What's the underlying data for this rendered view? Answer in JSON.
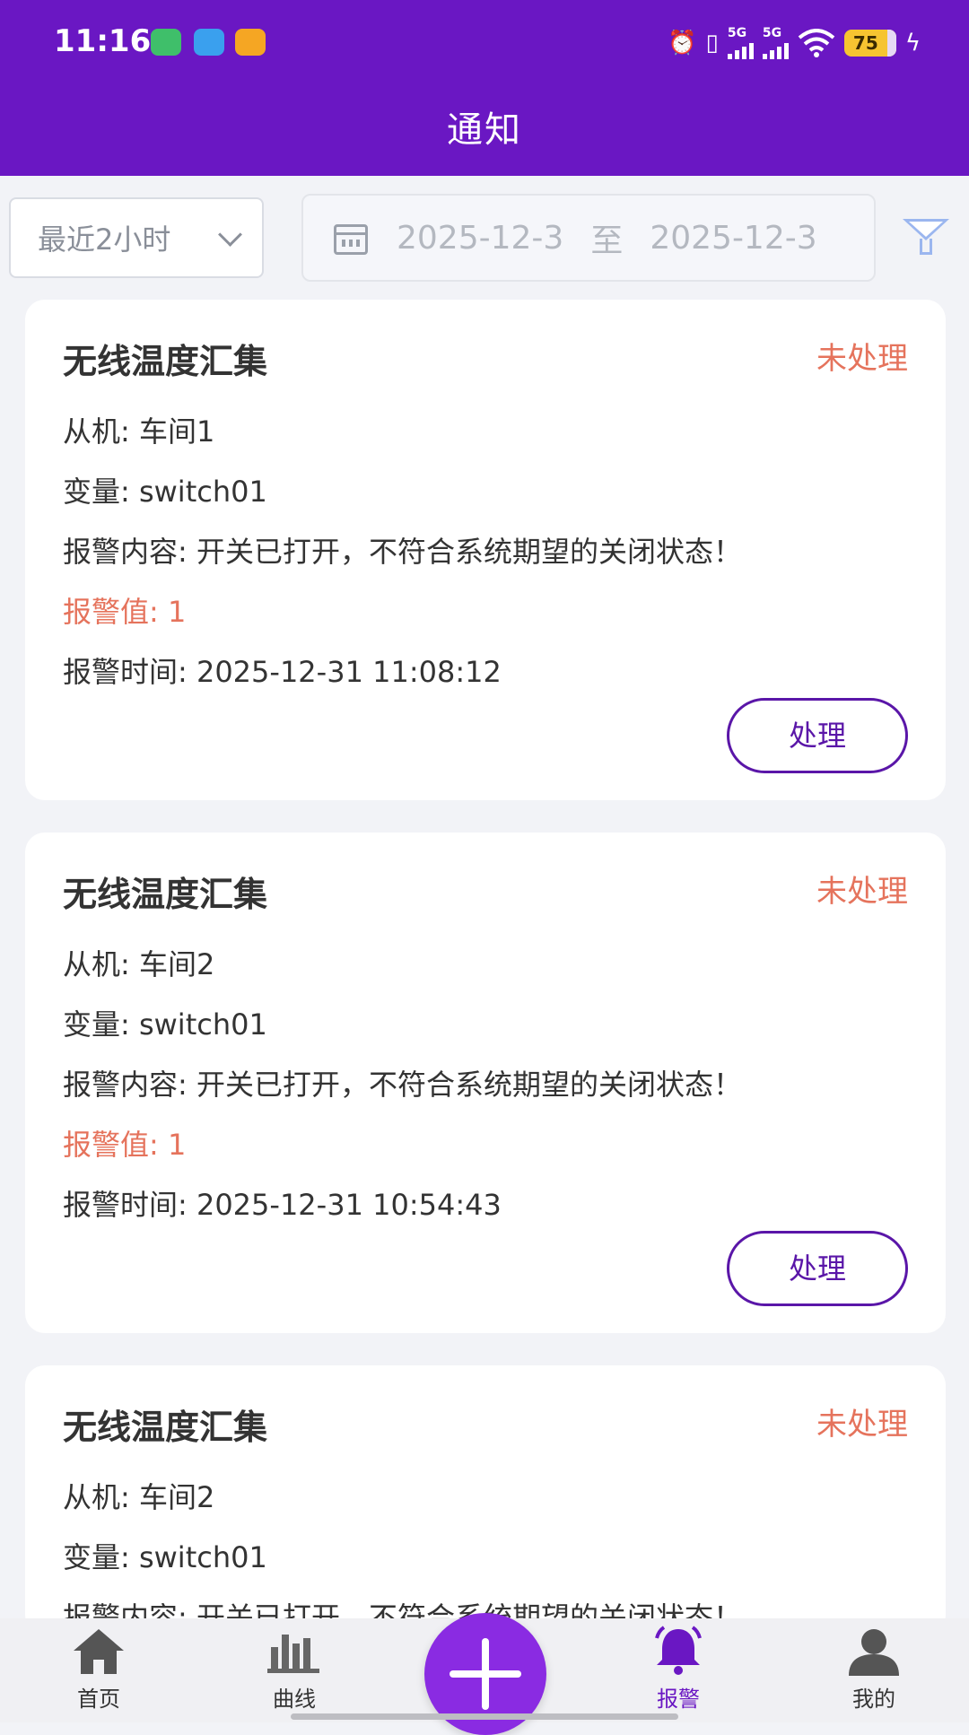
{
  "status_bar": {
    "time": "11:16",
    "network_label_1": "5G",
    "network_label_2": "5G",
    "battery": "75"
  },
  "header": {
    "title": "通知"
  },
  "filter": {
    "range_select": "最近2小时",
    "date_start": "2025-12-3",
    "date_separator": "至",
    "date_end": "2025-12-3"
  },
  "cards": [
    {
      "title": "无线温度汇集",
      "status": "未处理",
      "slave": "从机: 车间1",
      "variable": "变量: switch01",
      "content": "报警内容: 开关已打开，不符合系统期望的关闭状态！",
      "value": "报警值: 1",
      "time": "报警时间: 2025-12-31 11:08:12",
      "button": "处理"
    },
    {
      "title": "无线温度汇集",
      "status": "未处理",
      "slave": "从机: 车间2",
      "variable": "变量: switch01",
      "content": "报警内容: 开关已打开，不符合系统期望的关闭状态！",
      "value": "报警值: 1",
      "time": "报警时间: 2025-12-31 10:54:43",
      "button": "处理"
    },
    {
      "title": "无线温度汇集",
      "status": "未处理",
      "slave": "从机: 车间2",
      "variable": "变量: switch01",
      "content": "报警内容: 开关已打开，不符合系统期望的关闭状态！"
    }
  ],
  "tabbar": {
    "home": "首页",
    "curve": "曲线",
    "alarm": "报警",
    "mine": "我的"
  },
  "colors": {
    "brand": "#6a17c3",
    "alert": "#e5735c",
    "button_border": "#5a16a8",
    "fab": "#8a2be2"
  }
}
